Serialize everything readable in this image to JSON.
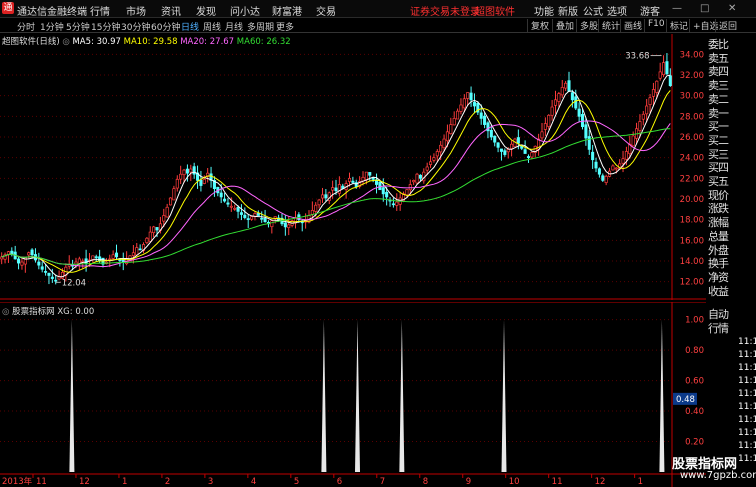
{
  "titlebar": {
    "app_title": "通达信金融终端",
    "menus": [
      "行情",
      "市场",
      "资讯",
      "发现",
      "问小达",
      "财富港",
      "交易"
    ],
    "notice": "证券交易未登录",
    "notice2": "超图软件",
    "right_menus": [
      "功能",
      "新版",
      "公式",
      "选项"
    ],
    "guest": "游客"
  },
  "toolbar": {
    "periods": [
      "分时",
      "1分钟",
      "5分钟",
      "15分钟",
      "30分钟",
      "60分钟",
      "日线",
      "周线",
      "月线",
      "多周期",
      "更多"
    ],
    "active_period": "日线",
    "right_buttons": [
      "复权",
      "叠加",
      "多股",
      "统计",
      "画线",
      "F10",
      "标记",
      "+自选",
      "返回"
    ]
  },
  "main_legend": {
    "stock": "超图软件(日线)",
    "ma5": "MA5: 30.97",
    "ma10": "MA10: 29.58",
    "ma20": "MA20: 27.67",
    "ma60": "MA60: 26.32"
  },
  "indicator_legend": {
    "name": "股票指标网",
    "value": "XG: 0.00"
  },
  "chart_data": [
    {
      "type": "candlestick",
      "ylim": [
        11,
        35
      ],
      "y_ticks": [
        "34.00",
        "32.00",
        "30.00",
        "28.00",
        "26.00",
        "24.00",
        "22.00",
        "20.00",
        "18.00",
        "16.00",
        "14.00",
        "12.00"
      ],
      "annotations": {
        "high": "33.68",
        "low": "12.04"
      },
      "x_ticks": [
        "2013年",
        "11",
        "12",
        "1",
        "2",
        "3",
        "4",
        "5",
        "6",
        "7",
        "8",
        "9",
        "10",
        "11",
        "12",
        "1"
      ],
      "close": [
        14.4,
        14.6,
        14.9,
        14.7,
        14.2,
        13.8,
        13.9,
        14.3,
        14.8,
        14.6,
        14.1,
        13.6,
        13.2,
        12.9,
        12.6,
        12.3,
        12.1,
        12.5,
        12.9,
        13.4,
        13.7,
        13.5,
        13.9,
        14.2,
        14.0,
        13.8,
        14.1,
        14.5,
        14.3,
        14.0,
        13.7,
        13.9,
        14.2,
        14.6,
        14.4,
        14.1,
        13.9,
        14.2,
        14.5,
        14.8,
        15.3,
        15.1,
        15.6,
        16.2,
        16.8,
        17.3,
        17.0,
        17.6,
        18.4,
        19.2,
        20.1,
        21.0,
        21.9,
        22.4,
        22.8,
        22.5,
        22.9,
        22.4,
        21.8,
        21.3,
        21.9,
        22.5,
        21.8,
        21.0,
        20.6,
        20.2,
        19.8,
        19.5,
        19.3,
        19.1,
        18.8,
        18.5,
        18.2,
        18.0,
        18.3,
        18.6,
        18.4,
        18.1,
        17.8,
        17.6,
        17.9,
        18.3,
        18.0,
        17.6,
        17.3,
        17.5,
        17.9,
        18.2,
        18.0,
        17.7,
        17.9,
        18.4,
        18.9,
        19.4,
        19.9,
        20.4,
        20.1,
        20.6,
        21.1,
        20.8,
        21.4,
        21.0,
        21.5,
        22.0,
        21.6,
        21.2,
        21.7,
        22.1,
        22.6,
        22.3,
        21.9,
        21.4,
        20.9,
        20.5,
        20.2,
        19.8,
        19.5,
        19.7,
        20.1,
        20.5,
        20.9,
        21.4,
        21.8,
        22.4,
        22.0,
        22.6,
        23.1,
        23.6,
        24.0,
        24.6,
        25.2,
        25.8,
        26.5,
        27.2,
        27.8,
        28.5,
        29.1,
        29.7,
        30.3,
        29.6,
        29.0,
        28.4,
        27.8,
        27.2,
        26.6,
        26.0,
        25.5,
        25.0,
        24.6,
        24.3,
        24.8,
        25.3,
        25.8,
        25.4,
        24.9,
        24.4,
        24.0,
        24.5,
        25.1,
        25.8,
        26.5,
        27.3,
        28.1,
        28.9,
        29.6,
        30.2,
        30.8,
        31.2,
        30.4,
        29.6,
        28.8,
        28.0,
        27.0,
        25.9,
        24.8,
        23.8,
        23.0,
        22.4,
        21.8,
        22.2,
        22.7,
        23.2,
        23.0,
        23.4,
        23.9,
        24.6,
        25.3,
        26.1,
        26.8,
        27.5,
        28.2,
        29.0,
        29.8,
        30.6,
        31.4,
        32.3,
        33.2,
        32.1,
        30.97
      ]
    },
    {
      "type": "bar",
      "ylim": [
        0,
        1.05
      ],
      "y_ticks": [
        "1.00",
        "0.80",
        "0.60",
        "0.40",
        "0.20"
      ],
      "current_label": "0.48",
      "signal_positions": [
        0.107,
        0.482,
        0.532,
        0.598,
        0.75,
        0.985
      ],
      "values": [
        1,
        1,
        1,
        1,
        1,
        1
      ]
    }
  ],
  "right_panel": {
    "labels_top": [
      "委比",
      "卖五",
      "卖四",
      "卖三",
      "卖二",
      "卖一",
      "买一",
      "买二",
      "买三",
      "买四",
      "买五",
      "现价",
      "涨跌",
      "涨幅",
      "总量",
      "外盘",
      "换手",
      "净资",
      "收益"
    ],
    "labels_bottom": [
      "自动",
      "行情"
    ],
    "times": [
      "11:1",
      "11:1",
      "11:1",
      "11:1",
      "11:1",
      "11:1",
      "11:1",
      "11:1",
      "11:1",
      "11:1"
    ]
  },
  "watermark": {
    "title": "股票指标网",
    "url": "www.7gpzb.com"
  },
  "colors": {
    "up": "#ff3c3c",
    "down": "#54ffff",
    "ma5": "#ffffff",
    "ma10": "#ffff00",
    "ma20": "#ff66ff",
    "ma60": "#33dd33",
    "axis": "#c00000"
  }
}
